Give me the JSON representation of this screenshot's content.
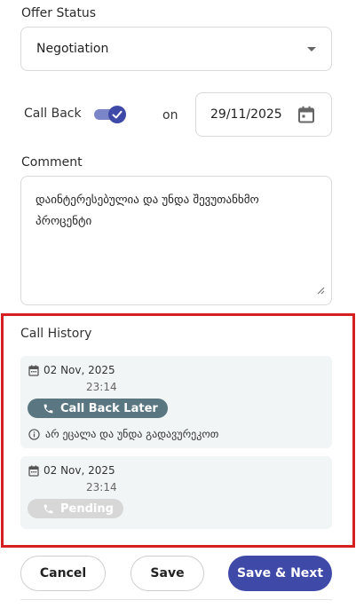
{
  "offer_status": {
    "label": "Offer Status",
    "value": "Negotiation"
  },
  "callback": {
    "label": "Call Back",
    "enabled": true,
    "on_label": "on",
    "date": "29/11/2025"
  },
  "comment": {
    "label": "Comment",
    "text": "დაინტერესებულია და უნდა შევუთანხმო პროცენტი"
  },
  "history": {
    "title": "Call History",
    "entries": [
      {
        "date": "02 Nov, 2025",
        "time": "23:14",
        "status": "Call Back Later",
        "note": "არ ეცალა და უნდა გადავურეკოთ"
      },
      {
        "date": "02 Nov, 2025",
        "time": "23:14",
        "status": "Pending"
      }
    ]
  },
  "actions": {
    "cancel": "Cancel",
    "save": "Save",
    "save_next": "Save & Next"
  },
  "colors": {
    "primary": "#3f49a8",
    "chip_dark": "#5a7680",
    "highlight": "#d42020"
  }
}
